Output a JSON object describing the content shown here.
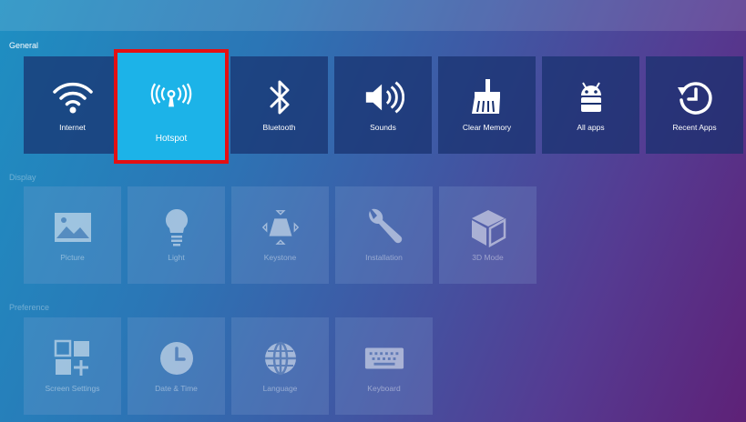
{
  "sections": [
    {
      "label": "General",
      "dimmed": false,
      "tiles": [
        {
          "label": "Internet",
          "icon": "wifi-icon"
        },
        {
          "label": "Hotspot",
          "icon": "hotspot-icon",
          "selected": true
        },
        {
          "label": "Bluetooth",
          "icon": "bluetooth-icon"
        },
        {
          "label": "Sounds",
          "icon": "speaker-icon"
        },
        {
          "label": "Clear Memory",
          "icon": "broom-icon"
        },
        {
          "label": "All apps",
          "icon": "android-icon"
        },
        {
          "label": "Recent Apps",
          "icon": "history-icon"
        }
      ]
    },
    {
      "label": "Display",
      "dimmed": true,
      "tiles": [
        {
          "label": "Picture",
          "icon": "image-icon"
        },
        {
          "label": "Light",
          "icon": "lightbulb-icon"
        },
        {
          "label": "Keystone",
          "icon": "keystone-icon"
        },
        {
          "label": "Installation",
          "icon": "wrench-icon"
        },
        {
          "label": "3D Mode",
          "icon": "cube-icon"
        }
      ]
    },
    {
      "label": "Preference",
      "dimmed": true,
      "tiles": [
        {
          "label": "Screen Settings",
          "icon": "grid-plus-icon"
        },
        {
          "label": "Date & Time",
          "icon": "clock-icon"
        },
        {
          "label": "Language",
          "icon": "globe-icon"
        },
        {
          "label": "Keyboard",
          "icon": "keyboard-icon"
        }
      ]
    }
  ],
  "colors": {
    "selected_tile": "#1cb3e8",
    "selection_border": "#e50f12",
    "tile": "#18306e"
  }
}
